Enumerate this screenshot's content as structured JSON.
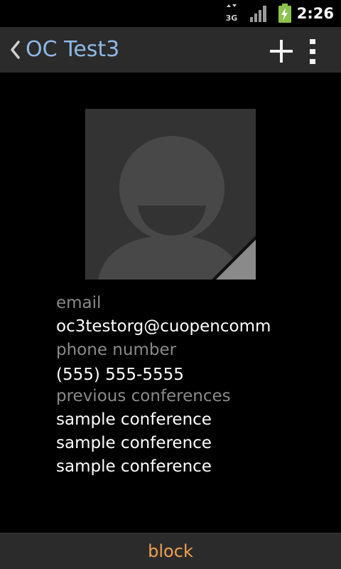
{
  "status_bar": {
    "network_type": "3G",
    "time": "2:26",
    "icons": [
      "data-3g-icon",
      "signal-icon",
      "battery-charging-icon"
    ]
  },
  "action_bar": {
    "title": "OC Test3",
    "title_color": "#8fb8e6",
    "back_icon": "chevron-left-icon",
    "add_icon": "plus-icon",
    "overflow_icon": "overflow-menu-icon"
  },
  "contact": {
    "avatar_icon": "default-contact-photo-icon",
    "email_label": "email",
    "email_value": "oc3testorg@cuopencomm",
    "phone_label": "phone number",
    "phone_value": "(555) 555-5555",
    "conferences_label": "previous conferences",
    "conferences": [
      "sample conference",
      "sample conference",
      "sample conference"
    ]
  },
  "bottom_bar": {
    "block_label": "block",
    "block_color": "#f0a050"
  }
}
